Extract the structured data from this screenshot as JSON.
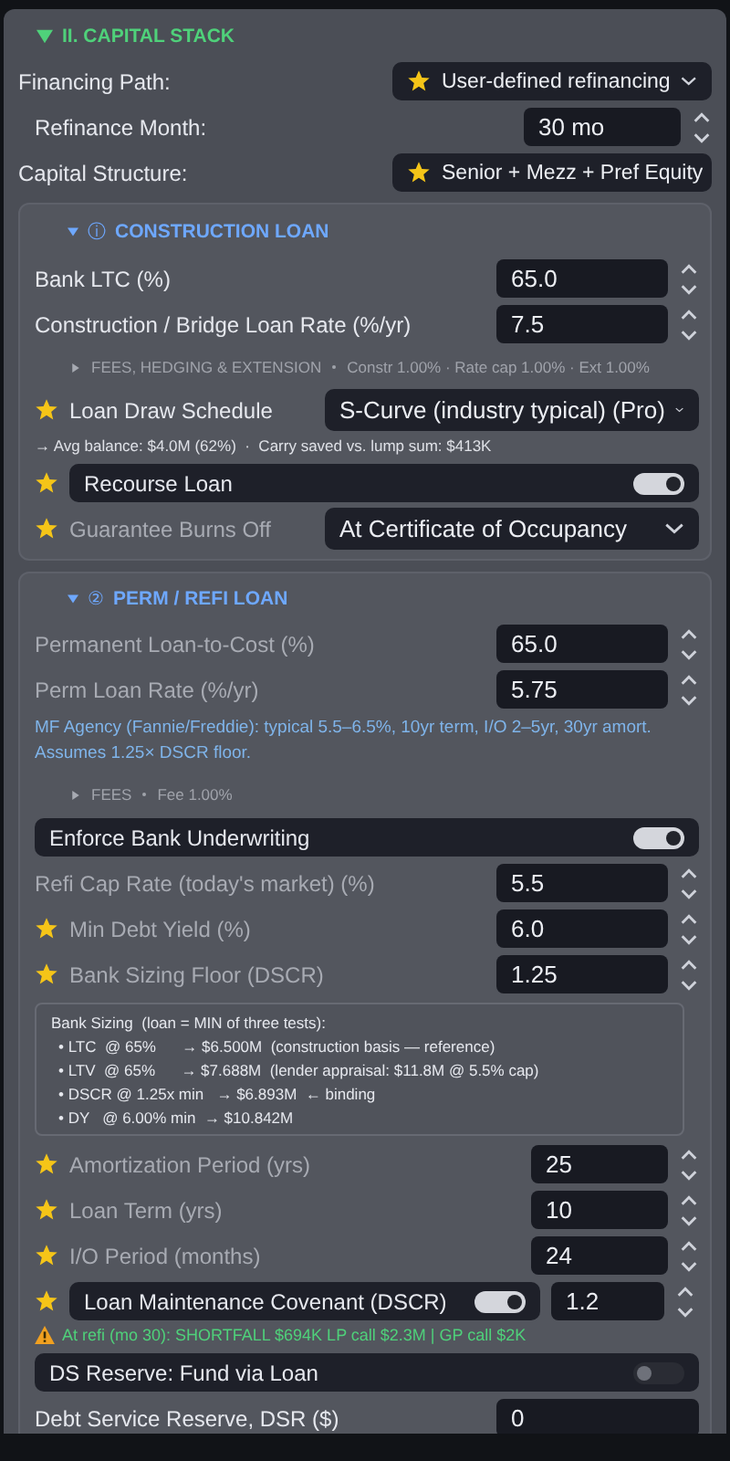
{
  "section": {
    "title": "II. CAPITAL STACK",
    "expanded": true,
    "rows": [
      {
        "kind": "select",
        "label": "Financing Path:",
        "value": "User-defined refinancing",
        "starred": true
      },
      {
        "kind": "month",
        "label": "Refinance Month:",
        "value": "30  mo"
      },
      {
        "kind": "select",
        "label": "Capital Structure:",
        "value": "Senior + Mezz + Pref Equity",
        "starred": true
      }
    ],
    "cards": [
      {
        "badge": "ⓘ",
        "title": "CONSTRUCTION LOAN",
        "expanded": true,
        "rows": [
          {
            "kind": "number",
            "label": "Bank LTC (%)",
            "value": "65.0",
            "muted": false,
            "starred": false
          },
          {
            "kind": "number",
            "label": "Construction / Bridge Loan Rate (%/yr)",
            "value": "7.5",
            "muted": false,
            "starred": false
          },
          {
            "kind": "disclosure",
            "label": "FEES, HEDGING & EXTENSION",
            "detail": "Constr 1.00% · Rate cap 1.00% · Ext 1.00%",
            "expanded": false
          },
          {
            "kind": "choice",
            "label": "Loan Draw Schedule",
            "value": "S-Curve (industry typical) (Pro)",
            "muted": false,
            "starred": true
          },
          {
            "kind": "note",
            "text": "→ Avg balance: $4.0M (62%)  ·  Carry saved vs. lump sum: $413K"
          },
          {
            "kind": "toggle",
            "label": "Recourse Loan",
            "on": true,
            "starred": true
          },
          {
            "kind": "choice",
            "label": "Guarantee Burns Off",
            "value": "At Certificate of Occupancy",
            "muted": true,
            "starred": true
          }
        ]
      },
      {
        "badge": "②",
        "title": "PERM / REFI LOAN",
        "expanded": true,
        "rows": [
          {
            "kind": "number",
            "label": "Permanent Loan-to-Cost (%)",
            "value": "65.0",
            "muted": true,
            "starred": false
          },
          {
            "kind": "number",
            "label": "Perm Loan Rate (%/yr)",
            "value": "5.75",
            "muted": true,
            "starred": false
          },
          {
            "kind": "info",
            "text": "MF Agency (Fannie/Freddie): typical 5.5–6.5%, 10yr term, I/O 2–5yr, 30yr amort. Assumes 1.25× DSCR floor."
          },
          {
            "kind": "disclosure",
            "label": "FEES",
            "detail": "Fee 1.00%",
            "expanded": false
          },
          {
            "kind": "toggle",
            "label": "Enforce Bank Underwriting",
            "on": true,
            "starred": false
          },
          {
            "kind": "number",
            "label": "Refi Cap Rate (today's market) (%)",
            "value": "5.5",
            "muted": true,
            "starred": false
          },
          {
            "kind": "number",
            "label": "Min Debt Yield (%)",
            "value": "6.0",
            "muted": true,
            "starred": true
          },
          {
            "kind": "number",
            "label": "Bank Sizing Floor (DSCR)",
            "value": "1.25",
            "muted": true,
            "starred": true
          },
          {
            "kind": "sizing",
            "title": "Bank Sizing  (loan = MIN of three tests):",
            "lines": [
              "• LTC  @ 65%      → $6.500M  (construction basis — reference)",
              "• LTV  @ 65%      → $7.688M  (lender appraisal: $11.8M @ 5.5% cap)",
              "• DSCR @ 1.25x min   → $6.893M  ← binding",
              "• DY   @ 6.00% min  → $10.842M"
            ]
          },
          {
            "kind": "integer",
            "label": "Amortization Period (yrs)",
            "value": "25",
            "muted": true,
            "starred": true
          },
          {
            "kind": "integer",
            "label": "Loan Term (yrs)",
            "value": "10",
            "muted": true,
            "starred": true
          },
          {
            "kind": "integer",
            "label": "I/O Period (months)",
            "value": "24",
            "muted": true,
            "starred": true
          },
          {
            "kind": "covenant",
            "label": "Loan Maintenance Covenant (DSCR)",
            "on": true,
            "value": "1.2",
            "starred": true
          },
          {
            "kind": "warning",
            "text": "At refi (mo 30): SHORTFALL $694K  LP call $2.3M | GP call $2K"
          },
          {
            "kind": "toggle",
            "label": "DS Reserve: Fund via Loan",
            "on": false,
            "starred": false
          },
          {
            "kind": "plain",
            "label": "Debt Service Reserve, DSR ($)",
            "value": "0",
            "muted": false,
            "starred": false
          }
        ]
      }
    ]
  }
}
